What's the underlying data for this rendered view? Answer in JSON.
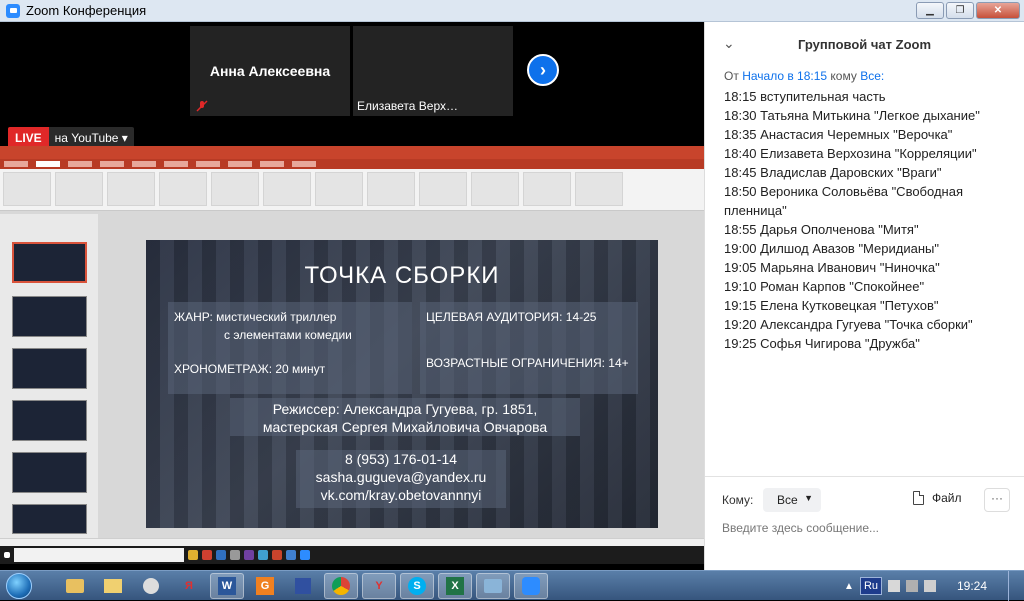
{
  "window": {
    "title": "Zoom Конференция"
  },
  "video": {
    "participants": [
      {
        "name": "Анна Алексеевна"
      },
      {
        "name": "Елизавета Верх…"
      }
    ],
    "live_badge": "LIVE",
    "live_target": "на YouTube"
  },
  "slide": {
    "title": "ТОЧКА СБОРКИ",
    "genre_line1": "ЖАНР:  мистический триллер",
    "genre_line2": "с элементами комедии",
    "duration": "ХРОНОМЕТРАЖ: 20 минут",
    "audience": "ЦЕЛЕВАЯ АУДИТОРИЯ: 14-25",
    "age": "ВОЗРАСТНЫЕ ОГРАНИЧЕНИЯ: 14+",
    "director": "Режиссер: Александра Гугуева, гр. 1851,",
    "workshop": "мастерская Сергея Михайловича Овчарова",
    "phone": "8 (953) 176-01-14",
    "email": "sasha.gugueva@yandex.ru",
    "vk": "vk.com/kray.obetovannnyi"
  },
  "chat": {
    "header": "Групповой чат Zoom",
    "from_prefix": "От",
    "from_who": "Начало в 18:15",
    "to_word": "кому",
    "to_who": "Все:",
    "messages": [
      "18:15 вступительная часть",
      "18:30 Татьяна Митькина \"Легкое дыхание\"",
      "18:35 Анастасия Черемных \"Верочка\"",
      "18:40 Елизавета Верхозина \"Корреляции\"",
      "18:45 Владислав Даровских \"Враги\"",
      "18:50 Вероника Соловьёва \"Свободная пленница\"",
      "18:55 Дарья Ополченова \"Митя\"",
      "19:00 Дилшод Авазов \"Меридианы\"",
      "19:05 Марьяна Иванович \"Ниночка\"",
      "19:10 Роман Карпов \"Спокойнее\"",
      "19:15 Елена Кутковецкая \"Петухов\"",
      "19:20 Александра Гугуева \"Точка сборки\"",
      "19:25 Софья Чигирова \"Дружба\""
    ],
    "to_label": "Кому:",
    "recipient": "Все",
    "file_label": "Файл",
    "more_label": "···",
    "input_placeholder": "Введите здесь сообщение..."
  },
  "taskbar": {
    "lang": "Ru",
    "time": "19:24"
  },
  "colors": {
    "zoom_blue": "#0e71eb",
    "live_red": "#e02828",
    "ppt_red": "#c8442c"
  }
}
